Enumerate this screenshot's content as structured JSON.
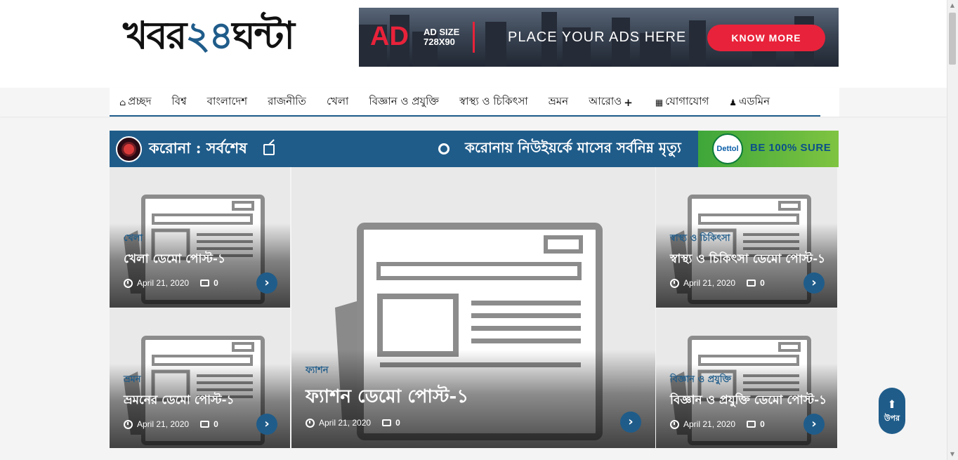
{
  "site": {
    "logo_prefix": "খবর",
    "logo_number": "২৪",
    "logo_suffix": "ঘন্টা"
  },
  "ad_banner": {
    "big_text": "AD",
    "size_line1": "AD SIZE",
    "size_line2": "728X90",
    "tagline": "PLACE YOUR ADS HERE",
    "button_label": "KNOW MORE"
  },
  "nav": {
    "items": [
      {
        "label": "প্রচ্ছদ",
        "icon": "home-icon"
      },
      {
        "label": "বিশ্ব"
      },
      {
        "label": "বাংলাদেশ"
      },
      {
        "label": "রাজনীতি"
      },
      {
        "label": "খেলা"
      },
      {
        "label": "বিজ্ঞান ও প্রযুক্তি"
      },
      {
        "label": "স্বাস্থ্য ও চিকিৎসা"
      },
      {
        "label": "ভ্রমন"
      },
      {
        "label": "আরোও",
        "icon": "plus-icon"
      },
      {
        "label": "যোগাযোগ",
        "icon": "contact-icon"
      },
      {
        "label": "এডমিন",
        "icon": "user-icon"
      }
    ]
  },
  "breaking": {
    "label": "করোনা : সর্বশেষ",
    "ticker_text": "করোনায় নিউইয়র্কে মাসের সর্বনিম্ন মৃত্যু",
    "sponsor_logo": "Dettol",
    "sponsor_text": "BE 100% SURE"
  },
  "posts": [
    {
      "category": "খেলা",
      "title": "খেলা ডেমো পোস্ট-১",
      "date": "April 21, 2020",
      "comments": "0"
    },
    {
      "category": "ভ্রমন",
      "title": "ভ্রমনের ডেমো পোস্ট-১",
      "date": "April 21, 2020",
      "comments": "0"
    },
    {
      "category": "ফ্যাশন",
      "title": "ফ্যাশন ডেমো পোস্ট-১",
      "date": "April 21, 2020",
      "comments": "0"
    },
    {
      "category": "স্বাস্থ্য ও চিকিৎসা",
      "title": "স্বাস্থ্য ও চিকিৎসা ডেমো পোস্ট-১",
      "date": "April 21, 2020",
      "comments": "0"
    },
    {
      "category": "বিজ্ঞান ও প্রযুক্তি",
      "title": "বিজ্ঞান ও প্রযুক্তি ডেমো পোস্ট-১",
      "date": "April 21, 2020",
      "comments": "0"
    }
  ],
  "scroll_top": {
    "label": "উপর"
  },
  "colors": {
    "primary": "#1f5c8a",
    "ad_red": "#e8223a",
    "sponsor_green": "#5cb53d"
  }
}
